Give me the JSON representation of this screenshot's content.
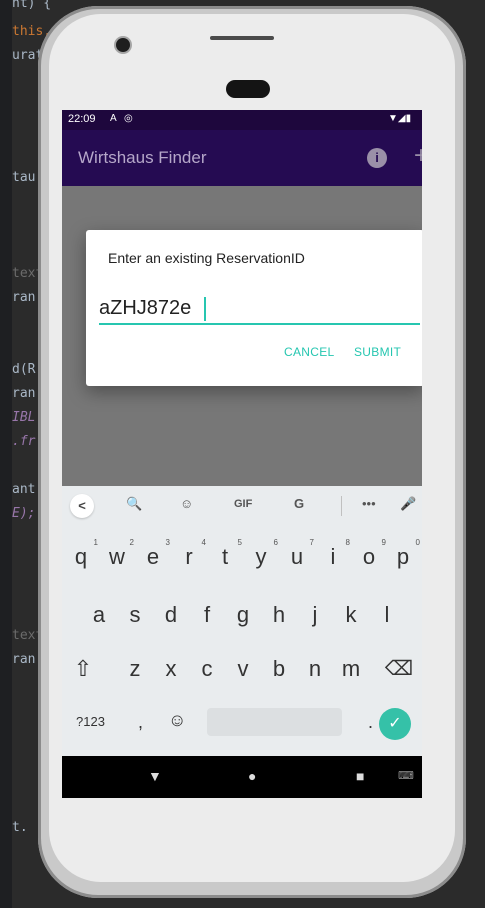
{
  "ide": {
    "lines": [
      {
        "text": "nt) {",
        "cls": ""
      },
      {
        "text": "this,",
        "cls": "kw"
      },
      {
        "text": "urat",
        "cls": ""
      },
      {
        "text": "tau",
        "cls": ""
      },
      {
        "text": "text",
        "cls": "dim"
      },
      {
        "text": "ran",
        "cls": ""
      },
      {
        "text": "d(R",
        "cls": ""
      },
      {
        "text": "ran",
        "cls": ""
      },
      {
        "text": "IBL",
        "cls": "it"
      },
      {
        "text": ".fr",
        "cls": "it"
      },
      {
        "text": "ant",
        "cls": ""
      },
      {
        "text": "E);",
        "cls": "it"
      },
      {
        "text": "text",
        "cls": "dim"
      },
      {
        "text": "ran",
        "cls": ""
      },
      {
        "text": "t.",
        "cls": ""
      }
    ]
  },
  "statusbar": {
    "time": "22:09",
    "icons": [
      "A",
      "◎"
    ],
    "signal": "▼◢▮"
  },
  "appbar": {
    "title": "Wirtshaus Finder",
    "info_icon": "i",
    "add_icon": "+"
  },
  "dialog": {
    "title": "Enter an existing ReservationID",
    "input_value": "aZHJ872e",
    "cancel_label": "CANCEL",
    "submit_label": "SUBMIT"
  },
  "keyboard": {
    "toolbar": {
      "back": "<",
      "search": "🔍",
      "sticker": "☺",
      "gif": "GIF",
      "translate": "G",
      "more": "•••",
      "mic": "🎤"
    },
    "row1": [
      {
        "k": "q",
        "n": "1"
      },
      {
        "k": "w",
        "n": "2"
      },
      {
        "k": "e",
        "n": "3"
      },
      {
        "k": "r",
        "n": "4"
      },
      {
        "k": "t",
        "n": "5"
      },
      {
        "k": "y",
        "n": "6"
      },
      {
        "k": "u",
        "n": "7"
      },
      {
        "k": "i",
        "n": "8"
      },
      {
        "k": "o",
        "n": "9"
      },
      {
        "k": "p",
        "n": "0"
      }
    ],
    "row2": [
      "a",
      "s",
      "d",
      "f",
      "g",
      "h",
      "j",
      "k",
      "l"
    ],
    "row3": [
      "z",
      "x",
      "c",
      "v",
      "b",
      "n",
      "m"
    ],
    "shift": "⇧",
    "backspace": "⌫",
    "symbols": "?123",
    "comma": ",",
    "emoji": "☺",
    "period": ".",
    "enter": "✓"
  },
  "navbar": {
    "back": "▼",
    "home": "●",
    "recents": "■",
    "ime": "⌨"
  }
}
